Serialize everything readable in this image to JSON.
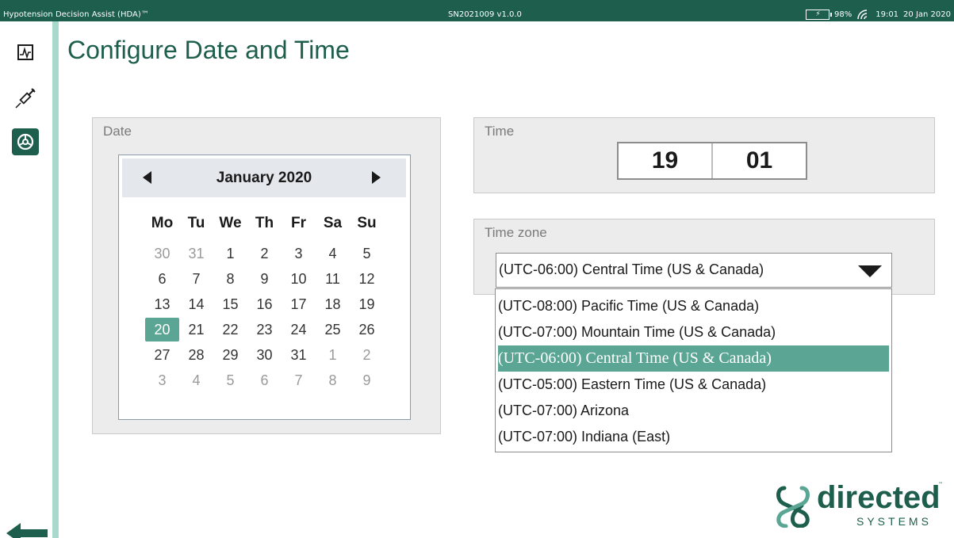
{
  "titlebar": {
    "app_title": "Hypotension Decision Assist (HDA)™",
    "serial": "SN2021009 v1.0.0",
    "battery_percent": "98%",
    "time": "19:01",
    "date": "20 Jan 2020"
  },
  "nav": {
    "items": [
      {
        "icon": "trend-monitor-icon",
        "active": false
      },
      {
        "icon": "syringe-icon",
        "active": false
      },
      {
        "icon": "settings-icon",
        "active": true
      }
    ],
    "back_icon": "back-arrow-icon"
  },
  "page": {
    "title": "Configure Date and Time"
  },
  "date_panel": {
    "label": "Date",
    "month": "January 2020",
    "weekdays": [
      "Mo",
      "Tu",
      "We",
      "Th",
      "Fr",
      "Sa",
      "Su"
    ],
    "weeks": [
      [
        {
          "d": "30",
          "o": true
        },
        {
          "d": "31",
          "o": true
        },
        {
          "d": "1"
        },
        {
          "d": "2"
        },
        {
          "d": "3"
        },
        {
          "d": "4"
        },
        {
          "d": "5"
        }
      ],
      [
        {
          "d": "6"
        },
        {
          "d": "7"
        },
        {
          "d": "8"
        },
        {
          "d": "9"
        },
        {
          "d": "10"
        },
        {
          "d": "11"
        },
        {
          "d": "12"
        }
      ],
      [
        {
          "d": "13"
        },
        {
          "d": "14"
        },
        {
          "d": "15"
        },
        {
          "d": "16"
        },
        {
          "d": "17"
        },
        {
          "d": "18"
        },
        {
          "d": "19"
        }
      ],
      [
        {
          "d": "20",
          "s": true
        },
        {
          "d": "21"
        },
        {
          "d": "22"
        },
        {
          "d": "23"
        },
        {
          "d": "24"
        },
        {
          "d": "25"
        },
        {
          "d": "26"
        }
      ],
      [
        {
          "d": "27"
        },
        {
          "d": "28"
        },
        {
          "d": "29"
        },
        {
          "d": "30"
        },
        {
          "d": "31"
        },
        {
          "d": "1",
          "o": true
        },
        {
          "d": "2",
          "o": true
        }
      ],
      [
        {
          "d": "3",
          "o": true
        },
        {
          "d": "4",
          "o": true
        },
        {
          "d": "5",
          "o": true
        },
        {
          "d": "6",
          "o": true
        },
        {
          "d": "7",
          "o": true
        },
        {
          "d": "8",
          "o": true
        },
        {
          "d": "9",
          "o": true
        }
      ]
    ]
  },
  "time_panel": {
    "label": "Time",
    "hour": "19",
    "minute": "01"
  },
  "timezone_panel": {
    "label": "Time zone",
    "selected": "(UTC-06:00) Central Time (US & Canada)",
    "options": [
      "(UTC-08:00) Pacific Time (US & Canada)",
      "(UTC-07:00) Mountain Time (US & Canada)",
      "(UTC-06:00) Central Time (US & Canada)",
      "(UTC-05:00) Eastern Time (US & Canada)",
      "(UTC-07:00) Arizona",
      "(UTC-07:00) Indiana (East)"
    ],
    "selected_index": 2
  },
  "logo": {
    "word": "directed",
    "sub": "SYSTEMS",
    "tm": "™"
  },
  "colors": {
    "brand": "#1d5e4c",
    "accent": "#5aa593",
    "nav_edge": "#a8d9cc"
  }
}
